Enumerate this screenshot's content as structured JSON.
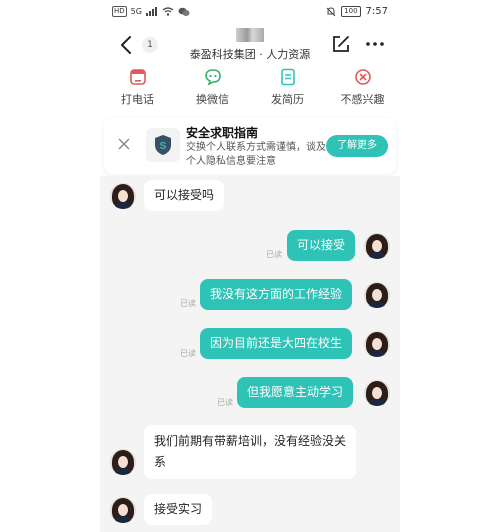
{
  "status_bar": {
    "network_left": "HD",
    "signal": "5G",
    "time": "7:57",
    "battery": "100"
  },
  "header": {
    "unread_count": "1",
    "company": "泰盈科技集团 · 人力资源"
  },
  "actions": [
    {
      "label": "打电话",
      "icon": "phone-icon"
    },
    {
      "label": "换微信",
      "icon": "wechat-icon"
    },
    {
      "label": "发简历",
      "icon": "resume-icon"
    },
    {
      "label": "不感兴趣",
      "icon": "not-interested-icon"
    }
  ],
  "tip": {
    "title": "安全求职指南",
    "desc": "交换个人联系方式需谨慎，谈及个人隐私信息要注意",
    "button": "了解更多"
  },
  "messages": [
    {
      "from": "hr",
      "text": "可以接受吗"
    },
    {
      "from": "me",
      "text": "可以接受",
      "status": "已读"
    },
    {
      "from": "me",
      "text": "我没有这方面的工作经验",
      "status": "已读"
    },
    {
      "from": "me",
      "text": "因为目前还是大四在校生",
      "status": "已读"
    },
    {
      "from": "me",
      "text": "但我愿意主动学习",
      "status": "已读"
    },
    {
      "from": "hr",
      "text": "我们前期有带薪培训，没有经验没关系"
    },
    {
      "from": "hr",
      "text": "接受实习"
    }
  ],
  "colors": {
    "accent": "#2fc2b6",
    "chat_bg": "#f4f4f5",
    "bubble_in": "#ffffff"
  }
}
